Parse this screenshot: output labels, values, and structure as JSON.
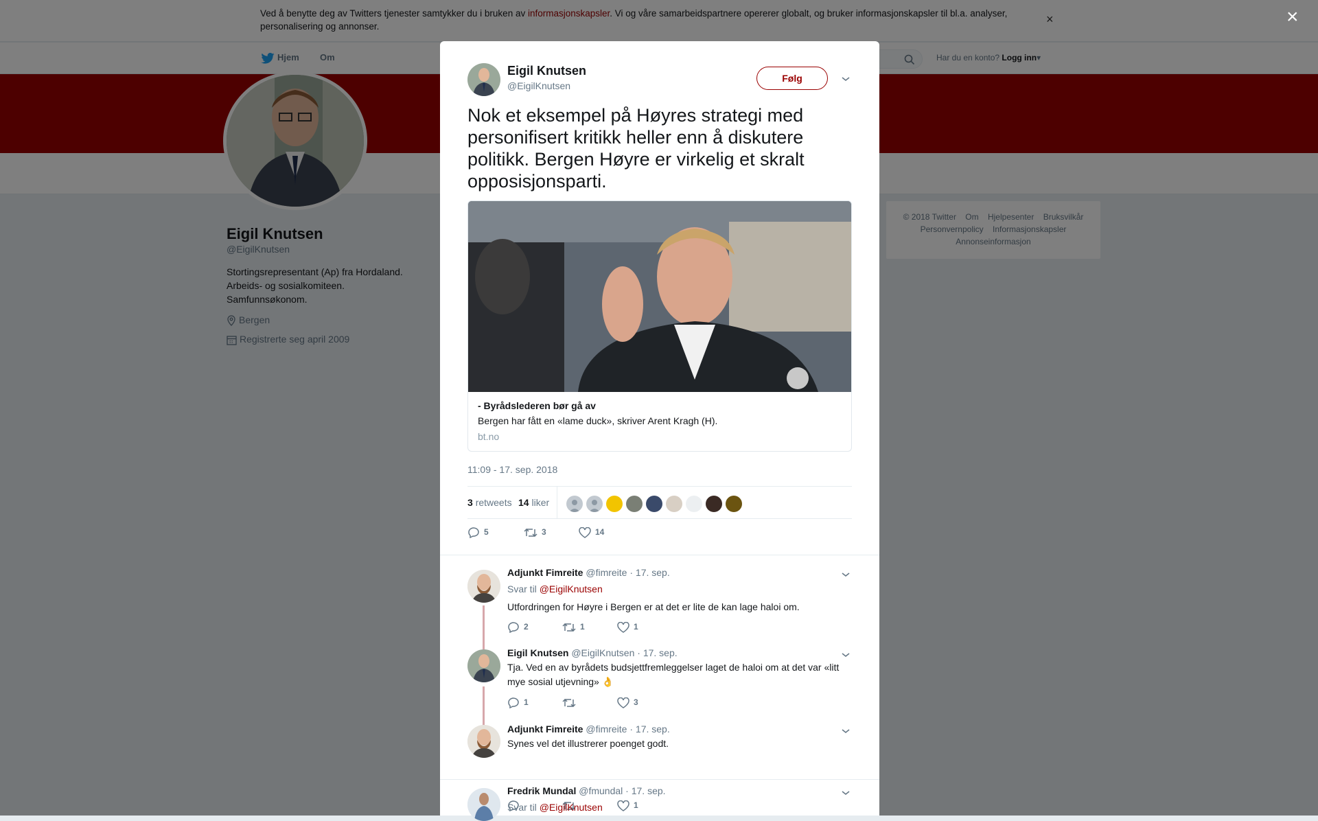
{
  "cookie_banner": {
    "text_before": "Ved å benytte deg av Twitters tjenester samtykker du i bruken av ",
    "link": "informasjonskapsler",
    "text_after": ". Vi og våre samarbeidspartnere opererer globalt, og bruker informasjonskapsler til bl.a. analyser, personalisering og annonser.",
    "close": "×"
  },
  "nav": {
    "home": "Hjem",
    "about": "Om",
    "account_prompt": "Har du en konto?",
    "login": "Logg inn"
  },
  "profile": {
    "name": "Eigil Knutsen",
    "handle": "@EigilKnutsen",
    "bio": "Stortingsrepresentant (Ap) fra Hordaland.\nArbeids- og sosialkomiteen.\nSamfunnsøkonom.",
    "location": "Bergen",
    "joined": "Registrerte seg april 2009"
  },
  "footer": {
    "links": [
      "© 2018 Twitter",
      "Om",
      "Hjelpesenter",
      "Bruksvilkår",
      "Personvernpolicy",
      "Informasjonskapsler",
      "Annonseinformasjon"
    ]
  },
  "overlay_close": "×",
  "tweet": {
    "name": "Eigil Knutsen",
    "handle": "@EigilKnutsen",
    "follow": "Følg",
    "text": "Nok et eksempel på Høyres strategi med personifisert kritikk heller enn å diskutere politikk. Bergen Høyre er virkelig et skralt opposisjonsparti.",
    "card": {
      "title": "- Byrådslederen bør gå av",
      "description": "Bergen har fått en «lame duck», skriver Arent Kragh (H).",
      "domain": "bt.no"
    },
    "timestamp": "11:09 - 17. sep. 2018",
    "retweets_count": "3",
    "retweets_label": "retweets",
    "likes_count": "14",
    "likes_label": "liker",
    "actions": {
      "replies": "5",
      "retweets": "3",
      "likes": "14"
    }
  },
  "replies": [
    {
      "name": "Adjunkt Fimreite",
      "handle": "@fimreite",
      "date": "· 17. sep.",
      "reply_to_label": "Svar til",
      "reply_to": "@EigilKnutsen",
      "text": "Utfordringen for Høyre i Bergen er at det er lite de kan lage haloi om.",
      "replies": "2",
      "retweets": "1",
      "likes": "1"
    },
    {
      "name": "Eigil Knutsen",
      "handle": "@EigilKnutsen",
      "date": "· 17. sep.",
      "text": "Tja. Ved en av byrådets budsjettfremleggelser laget de haloi om at det var «litt mye sosial utjevning» 👌",
      "replies": "1",
      "retweets": "",
      "likes": "3"
    },
    {
      "name": "Adjunkt Fimreite",
      "handle": "@fimreite",
      "date": "· 17. sep.",
      "text": "Synes vel det illustrerer poenget godt.",
      "replies": "",
      "retweets": "",
      "likes": "1"
    },
    {
      "name": "Fredrik Mundal",
      "handle": "@fmundal",
      "date": "· 17. sep.",
      "reply_to_label": "Svar til",
      "reply_to": "@EigilKnutsen"
    }
  ],
  "colors": {
    "accent": "#9a0000",
    "banner": "#9a0000",
    "muted": "#657786",
    "thread": "#d7a7ab"
  }
}
